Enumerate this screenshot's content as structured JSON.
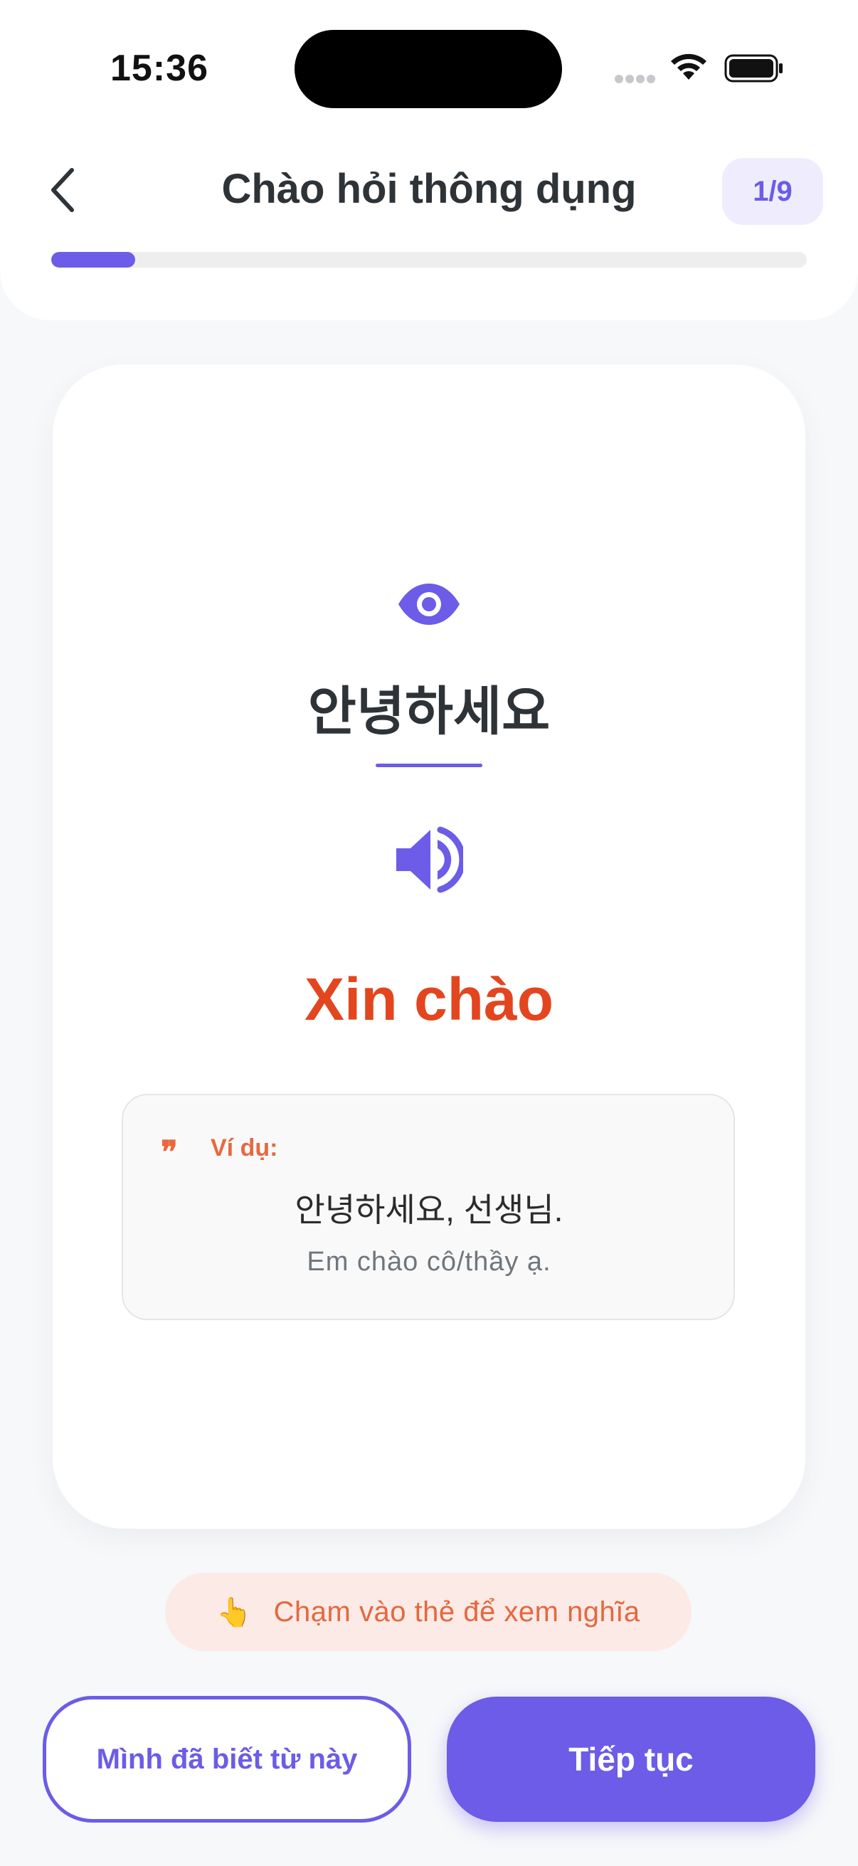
{
  "status_bar": {
    "time": "15:36"
  },
  "header": {
    "title": "Chào hỏi thông dụng",
    "counter": "1/9",
    "progress_fraction": 0.111
  },
  "card": {
    "korean_word": "안녕하세요",
    "meaning": "Xin chào",
    "example": {
      "label": "Ví dụ:",
      "korean": "안녕하세요, 선생님.",
      "translation": "Em chào cô/thầy ạ."
    }
  },
  "hint": {
    "icon": "👆",
    "text": "Chạm vào thẻ để xem nghĩa"
  },
  "buttons": {
    "known_label": "Mình đã biết từ này",
    "continue_label": "Tiếp tục"
  },
  "colors": {
    "accent": "#6c5ce7",
    "meaning": "#e3461f",
    "hint_text": "#e3683f",
    "hint_bg": "#fbeae6"
  },
  "icons": [
    "chevron-left-icon",
    "eye-icon",
    "speaker-icon",
    "quote-icon",
    "pointing-hand-icon",
    "wifi-icon",
    "battery-icon"
  ]
}
